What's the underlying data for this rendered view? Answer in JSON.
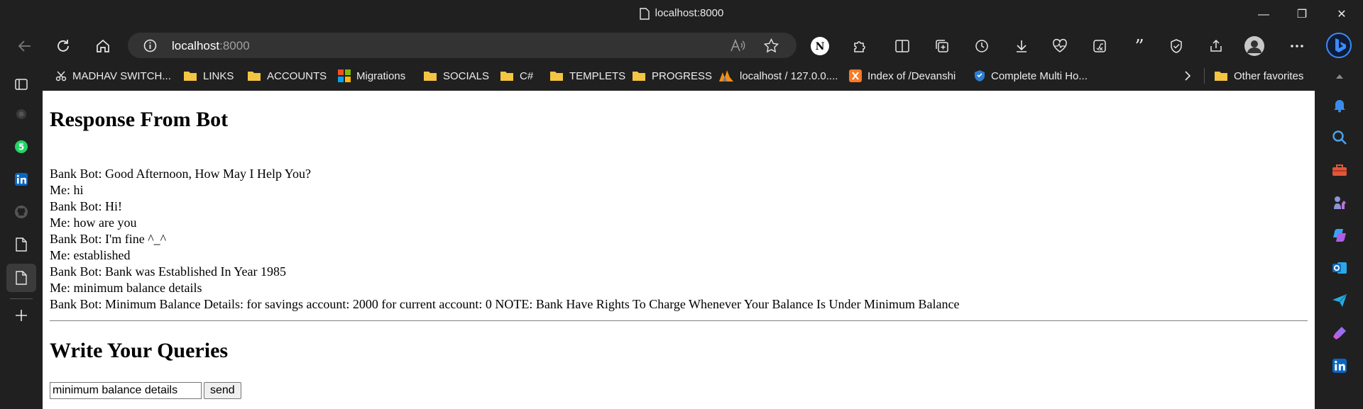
{
  "window": {
    "title": "localhost:8000"
  },
  "address_bar": {
    "host": "localhost",
    "port": ":8000"
  },
  "bookmarks": [
    {
      "label": "MADHAV SWITCH...",
      "icon": "scissors-icon"
    },
    {
      "label": "LINKS",
      "icon": "folder-icon"
    },
    {
      "label": "ACCOUNTS",
      "icon": "folder-icon"
    },
    {
      "label": "Migrations",
      "icon": "microsoft-logo-icon"
    },
    {
      "label": "SOCIALS",
      "icon": "folder-icon"
    },
    {
      "label": "C#",
      "icon": "folder-icon"
    },
    {
      "label": "TEMPLETS",
      "icon": "folder-icon"
    },
    {
      "label": "PROGRESS",
      "icon": "folder-icon"
    },
    {
      "label": "localhost / 127.0.0....",
      "icon": "phpmyadmin-icon"
    },
    {
      "label": "Index of /Devanshi",
      "icon": "xampp-icon"
    },
    {
      "label": "Complete Multi Ho...",
      "icon": "shield-icon"
    }
  ],
  "other_favorites": "Other favorites",
  "sidebar_badge": "5",
  "page": {
    "response_heading": "Response From Bot",
    "chat_lines": [
      "Bank Bot: Good Afternoon, How May I Help You?",
      "Me: hi",
      "Bank Bot: Hi!",
      "Me: how are you",
      "Bank Bot: I'm fine ^_^",
      "Me: established",
      "Bank Bot: Bank was Established In Year 1985",
      "Me: minimum balance details",
      "Bank Bot: Minimum Balance Details: for savings account: 2000 for current account: 0 NOTE: Bank Have Rights To Charge Whenever Your Balance Is Under Minimum Balance"
    ],
    "queries_heading": "Write Your Queries",
    "query_value": "minimum balance details",
    "send_label": "send"
  },
  "colors": {
    "chrome_bg": "#202020",
    "address_bg": "#333333",
    "folder": "#f4c542",
    "edge_blue": "#1a73e8"
  }
}
